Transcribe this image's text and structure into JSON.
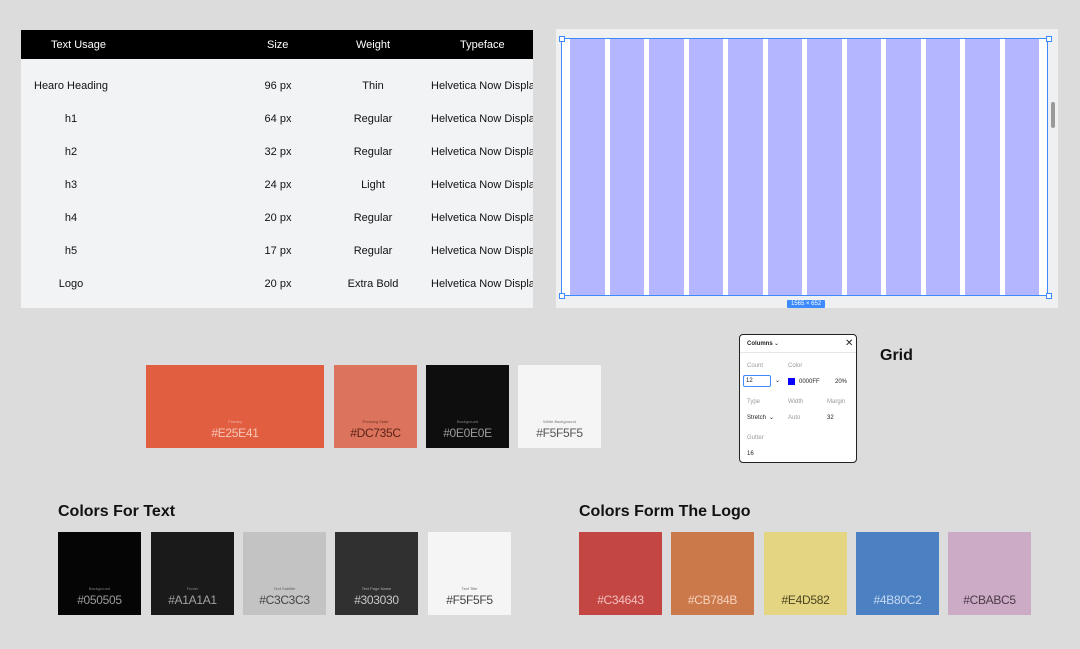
{
  "typography_table": {
    "headers": {
      "usage": "Text Usage",
      "size": "Size",
      "weight": "Weight",
      "typeface": "Typeface"
    },
    "rows": [
      {
        "usage": "Hearo Heading",
        "size": "96 px",
        "weight": "Thin",
        "typeface": "Helvetica Now Display"
      },
      {
        "usage": "h1",
        "size": "64 px",
        "weight": "Regular",
        "typeface": "Helvetica Now Display"
      },
      {
        "usage": "h2",
        "size": "32 px",
        "weight": "Regular",
        "typeface": "Helvetica Now Display"
      },
      {
        "usage": "h3",
        "size": "24 px",
        "weight": "Light",
        "typeface": "Helvetica Now Display"
      },
      {
        "usage": "h4",
        "size": "20 px",
        "weight": "Regular",
        "typeface": "Helvetica Now Display"
      },
      {
        "usage": "h5",
        "size": "17 px",
        "weight": "Regular",
        "typeface": "Helvetica Now Display"
      },
      {
        "usage": "Logo",
        "size": "20 px",
        "weight": "Extra Bold",
        "typeface": "Helvetica Now Display"
      }
    ]
  },
  "grid_preview": {
    "column_count": 12,
    "column_color": "#b4b6ff",
    "dimension_label": "1565 × 652"
  },
  "primary_colors": [
    {
      "label": "Primary",
      "hex": "#E25E41",
      "color": "#E25E41",
      "text_color": "#f6c7b9"
    },
    {
      "label": "Pressing State",
      "hex": "#DC735C",
      "color": "#DC735C",
      "text_color": "#5a2418"
    },
    {
      "label": "Background",
      "hex": "#0E0E0E",
      "color": "#0E0E0E",
      "text_color": "#9a9a9a"
    },
    {
      "label": "White Background",
      "hex": "#F5F5F5",
      "color": "#F5F5F5",
      "text_color": "#555555"
    }
  ],
  "columns_panel": {
    "title": "Columns",
    "count_label": "Count",
    "count_value": "12",
    "color_label": "Color",
    "color_value": "0000FF",
    "opacity_value": "20%",
    "type_label": "Type",
    "type_value": "Stretch",
    "width_label": "Width",
    "width_value": "Auto",
    "margin_label": "Margin",
    "margin_value": "32",
    "gutter_label": "Gutter",
    "gutter_value": "16",
    "chip_color": "#0a00ff"
  },
  "grid_heading": "Grid",
  "text_colors": {
    "heading": "Colors For Text",
    "swatches": [
      {
        "label": "Background",
        "hex": "#050505",
        "color": "#050505",
        "text_color": "#9a9a9a"
      },
      {
        "label": "Footer",
        "hex": "#A1A1A1",
        "color": "#1A1A1A",
        "text_color": "#a1a1a1"
      },
      {
        "label": "Text Subtitle",
        "hex": "#C3C3C3",
        "color": "#C3C3C3",
        "text_color": "#444444"
      },
      {
        "label": "Text Page Name",
        "hex": "#303030",
        "color": "#303030",
        "text_color": "#c9c9c9"
      },
      {
        "label": "Text Title",
        "hex": "#F5F5F5",
        "color": "#F5F5F5",
        "text_color": "#444444"
      }
    ]
  },
  "logo_colors": {
    "heading": "Colors Form The Logo",
    "swatches": [
      {
        "hex": "#C34643",
        "color": "#C34643",
        "text_color": "#f3c0bd"
      },
      {
        "hex": "#CB784B",
        "color": "#CB784B",
        "text_color": "#f7d2bc"
      },
      {
        "hex": "#E4D582",
        "color": "#E4D582",
        "text_color": "#4a4423"
      },
      {
        "hex": "#4B80C2",
        "color": "#4B80C2",
        "text_color": "#c6d9f2"
      },
      {
        "hex": "#CBABC5",
        "color": "#CBABC5",
        "text_color": "#4c3a48"
      }
    ]
  }
}
